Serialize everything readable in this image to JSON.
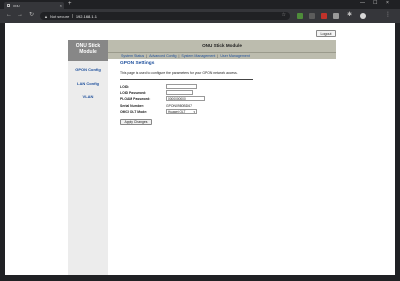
{
  "browser": {
    "tab_title": "ONU",
    "tab_close": "×",
    "new_tab": "+",
    "window_controls": {
      "minimize": "—",
      "maximize": "☐",
      "close": "×"
    },
    "security_label": "Not secure",
    "url": "192.168.1.1"
  },
  "page": {
    "logout_label": "Logout",
    "sidebar_title": "ONU Stick\nModule",
    "sidebar_links": [
      "GPON Config",
      "LAN Config",
      "VLAN"
    ],
    "header_title": "ONU Stick Module",
    "menu": [
      "System Status",
      "Advanced Config",
      "System Management",
      "User Management"
    ],
    "menu_separator": "|",
    "section_title": "GPON Settings",
    "description": "This page is used to configure the parameters for your GPON network access.",
    "form": {
      "loid_label": "LOID:",
      "loid_value": "",
      "loid_password_label": "LOID Password:",
      "loid_password_value": "",
      "ploam_label": "PLOAM Password:",
      "ploam_value": "0000000000",
      "serial_label": "Serial Number:",
      "serial_value": "GPON0980BD67",
      "omci_label": "OMCI OLT Mode:",
      "omci_value": "Huawei OLT",
      "apply_label": "Apply Changes"
    }
  },
  "colors": {
    "sidebar_header": "#878787",
    "header_bar": "#bcbcae",
    "link_blue": "#1d4f9c"
  }
}
